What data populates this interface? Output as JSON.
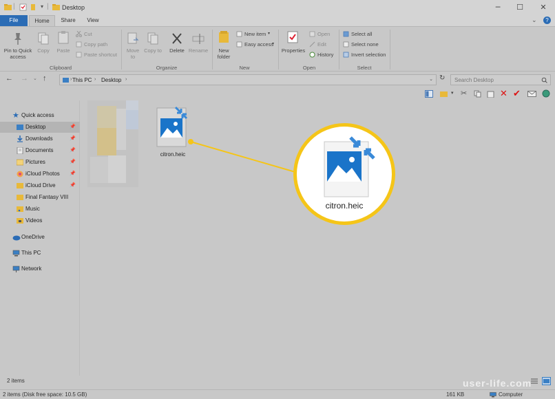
{
  "window": {
    "title": "Desktop",
    "controls": {
      "minimize": "─",
      "maximize": "☐",
      "close": "✕",
      "help": "?"
    }
  },
  "tabs": [
    "File",
    "Home",
    "Share",
    "View"
  ],
  "ribbon": {
    "clipboard": {
      "label": "Clipboard",
      "pin": "Pin to Quick access",
      "copy": "Copy",
      "paste": "Paste",
      "cut": "Cut",
      "copy_path": "Copy path",
      "paste_shortcut": "Paste shortcut"
    },
    "organize": {
      "label": "Organize",
      "move_to": "Move to",
      "copy_to": "Copy to",
      "delete": "Delete",
      "rename": "Rename"
    },
    "new": {
      "label": "New",
      "new_folder": "New folder",
      "new_item": "New item",
      "easy_access": "Easy access"
    },
    "open": {
      "label": "Open",
      "properties": "Properties",
      "open": "Open",
      "edit": "Edit",
      "history": "History"
    },
    "select": {
      "label": "Select",
      "select_all": "Select all",
      "select_none": "Select none",
      "invert": "Invert selection"
    }
  },
  "address": {
    "breadcrumb": [
      "This PC",
      "Desktop"
    ],
    "search_placeholder": "Search Desktop"
  },
  "nav": {
    "quick_access": "Quick access",
    "items": [
      "Desktop",
      "Downloads",
      "Documents",
      "Pictures",
      "iCloud Photos",
      "iCloud Drive",
      "Final Fantasy VIII",
      "Music",
      "Videos"
    ],
    "onedrive": "OneDrive",
    "this_pc": "This PC",
    "network": "Network"
  },
  "files": [
    {
      "name": "citron.heic",
      "icon": "image-icon"
    }
  ],
  "callout": {
    "name": "citron.heic"
  },
  "status": {
    "count": "2 items",
    "disk": "2 items (Disk free space: 10.5 GB)",
    "size": "161 KB",
    "location": "Computer"
  },
  "watermark": "user-life.com",
  "colors": {
    "accent": "#2b6cb5",
    "callout_ring": "#f5c518",
    "icon_blue": "#1a74c9"
  }
}
